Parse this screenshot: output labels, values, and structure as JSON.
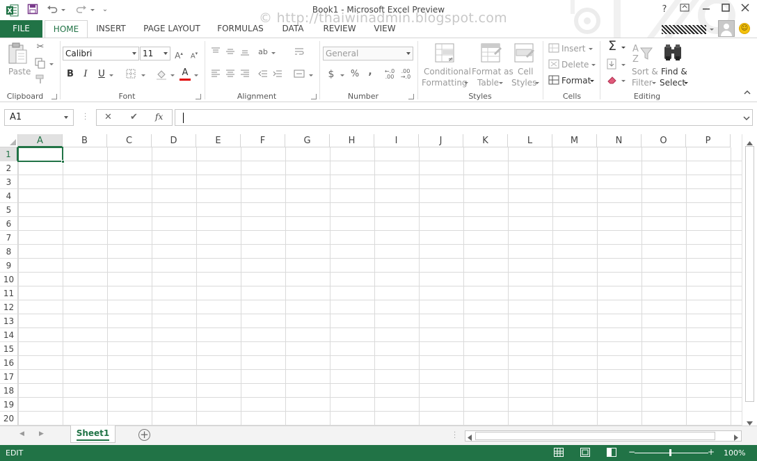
{
  "window": {
    "title": "Book1 - Microsoft Excel Preview",
    "watermark": "© http://thaiwinadmin.blogspot.com",
    "help_label": "?",
    "buttons": [
      "?",
      "restore-ribbon",
      "minimize",
      "maximize",
      "close"
    ]
  },
  "tabs": {
    "file": "FILE",
    "items": [
      "HOME",
      "INSERT",
      "PAGE LAYOUT",
      "FORMULAS",
      "DATA",
      "REVIEW",
      "VIEW"
    ],
    "active": "HOME"
  },
  "ribbon": {
    "clipboard": {
      "label": "Clipboard",
      "paste": "Paste"
    },
    "font": {
      "label": "Font",
      "name": "Calibri",
      "size": "11",
      "bold": "B",
      "italic": "I",
      "underline": "U"
    },
    "alignment": {
      "label": "Alignment"
    },
    "number": {
      "label": "Number",
      "format": "General",
      "currency": "$",
      "percent": "%",
      "comma": ","
    },
    "styles": {
      "label": "Styles",
      "conditional": [
        "Conditional",
        "Formatting"
      ],
      "format_table": [
        "Format as",
        "Table"
      ],
      "cell_styles": [
        "Cell",
        "Styles"
      ]
    },
    "cells": {
      "label": "Cells",
      "insert": "Insert",
      "delete": "Delete",
      "format": "Format"
    },
    "editing": {
      "label": "Editing",
      "autosum": "Σ",
      "sort": [
        "Sort &",
        "Filter"
      ],
      "find": [
        "Find &",
        "Select"
      ]
    }
  },
  "formula_bar": {
    "name_box": "A1",
    "cancel": "✕",
    "enter": "✔",
    "fx": "fx",
    "value": ""
  },
  "grid": {
    "columns": [
      "A",
      "B",
      "C",
      "D",
      "E",
      "F",
      "G",
      "H",
      "I",
      "J",
      "K",
      "L",
      "M",
      "N",
      "O",
      "P"
    ],
    "rows": [
      "1",
      "2",
      "3",
      "4",
      "5",
      "6",
      "7",
      "8",
      "9",
      "10",
      "11",
      "12",
      "13",
      "14",
      "15",
      "16",
      "17",
      "18",
      "19",
      "20"
    ],
    "active_cell": "A1"
  },
  "sheets": {
    "tabs": [
      "Sheet1"
    ],
    "active": "Sheet1",
    "add": "+"
  },
  "status": {
    "mode": "EDIT",
    "zoom_minus": "−",
    "zoom_plus": "+",
    "zoom": "100%"
  },
  "colors": {
    "accent": "#217346",
    "status_bar": "#217346",
    "font_color_bar": "#e00000"
  }
}
